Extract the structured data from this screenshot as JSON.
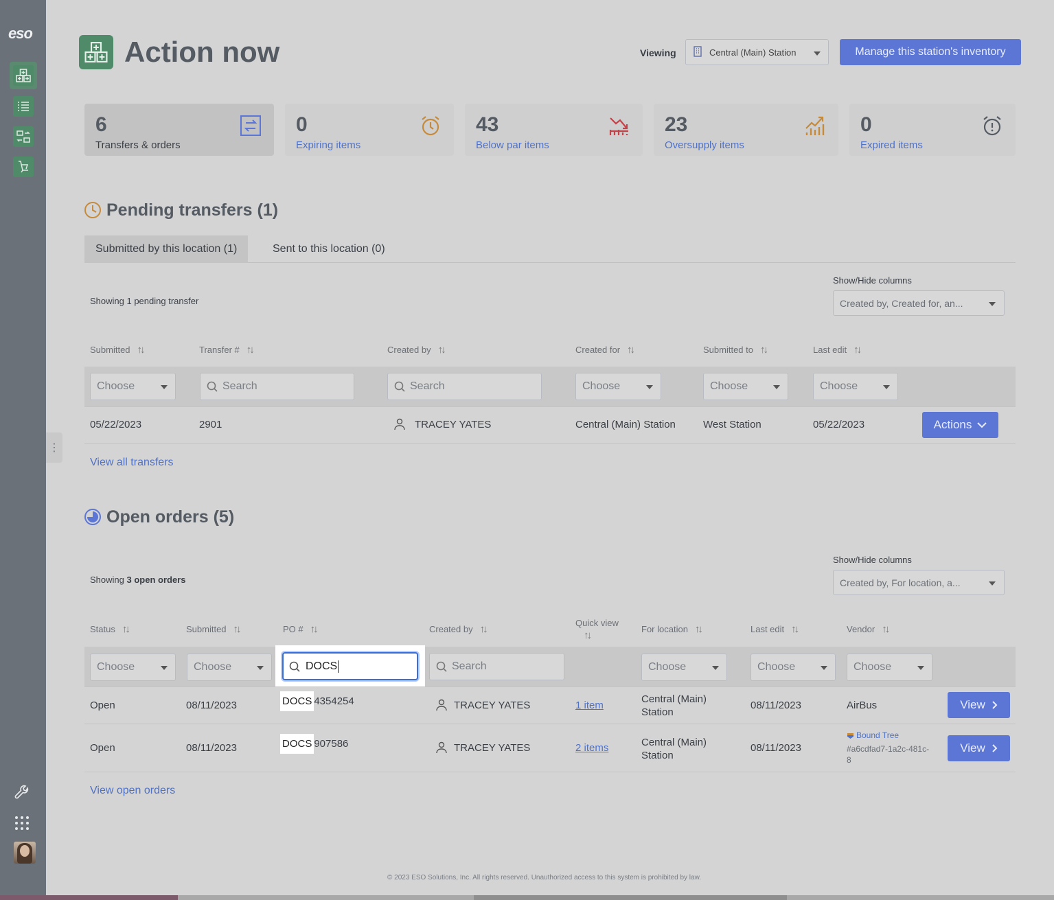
{
  "brand": "eso",
  "page": {
    "title": "Action now"
  },
  "header": {
    "viewing_label": "Viewing",
    "station": "Central (Main) Station",
    "manage_button": "Manage this station's inventory"
  },
  "stats": [
    {
      "value": "6",
      "label": "Transfers & orders",
      "icon": "transfer-icon"
    },
    {
      "value": "0",
      "label": "Expiring items",
      "icon": "alarm-clock-icon"
    },
    {
      "value": "43",
      "label": "Below par items",
      "icon": "trend-down-icon"
    },
    {
      "value": "23",
      "label": "Oversupply items",
      "icon": "trend-up-icon"
    },
    {
      "value": "0",
      "label": "Expired items",
      "icon": "alarm-alert-icon"
    }
  ],
  "pending": {
    "title": "Pending transfers (1)",
    "tabs": [
      "Submitted by this location (1)",
      "Sent to this location (0)"
    ],
    "showing": "Showing 1 pending transfer",
    "showhide_label": "Show/Hide columns",
    "showhide_value": "Created by, Created for, an...",
    "columns": [
      "Submitted",
      "Transfer #",
      "Created by",
      "Created for",
      "Submitted to",
      "Last edit"
    ],
    "filters": {
      "choose": "Choose",
      "search": "Search"
    },
    "row": {
      "submitted": "05/22/2023",
      "transfer": "2901",
      "created_by": "TRACEY YATES",
      "created_for": "Central (Main) Station",
      "submitted_to": "West Station",
      "last_edit": "05/22/2023",
      "action": "Actions"
    },
    "view_all": "View all transfers"
  },
  "orders": {
    "title": "Open orders (5)",
    "showing_prefix": "Showing",
    "showing_count": "3 open orders",
    "showhide_label": "Show/Hide columns",
    "showhide_value": "Created by, For location, a...",
    "columns": [
      "Status",
      "Submitted",
      "PO #",
      "Created by",
      "Quick view",
      "For location",
      "Last edit",
      "Vendor"
    ],
    "po_search_value": "DOCS",
    "rows": [
      {
        "status": "Open",
        "submitted": "08/11/2023",
        "po_match": "DOCS",
        "po_rest": "4354254",
        "created_by": "TRACEY YATES",
        "quick_view": "1 item",
        "location_line1": "Central (Main)",
        "location_line2": "Station",
        "last_edit": "08/11/2023",
        "vendor": "AirBus",
        "action": "View"
      },
      {
        "status": "Open",
        "submitted": "08/11/2023",
        "po_match": "DOCS",
        "po_rest": "907586",
        "created_by": "TRACEY YATES",
        "quick_view": "2 items",
        "location_line1": "Central (Main)",
        "location_line2": "Station",
        "last_edit": "08/11/2023",
        "vendor": "Bound Tree",
        "vendor_id_line1": "#a6cdfad7-1a2c-481c-",
        "vendor_id_line2": "8",
        "action": "View"
      }
    ],
    "view_all": "View open orders"
  },
  "footer": "© 2023 ESO Solutions, Inc. All rights reserved. Unauthorized access to this system is prohibited by law.",
  "colors": {
    "accent": "#5c76d6",
    "brand_green": "#4f8b69",
    "link": "#4f72c9",
    "highlight": "#ffffff"
  }
}
